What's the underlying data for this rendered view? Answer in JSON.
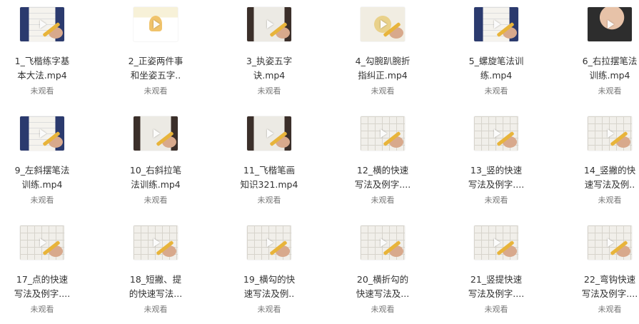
{
  "status_label": "未观看",
  "videos": [
    {
      "title": "1_飞楷练字基\n本大法.mp4",
      "thumb": "blue"
    },
    {
      "title": "2_正姿两件事\n和坐姿五字..",
      "thumb": "cartoon"
    },
    {
      "title": "3_执姿五字\n诀.mp4",
      "thumb": "dark"
    },
    {
      "title": "4_勾腕趴腕折\n指纠正.mp4",
      "thumb": "gold"
    },
    {
      "title": "5_螺旋笔法训\n练.mp4",
      "thumb": "blue"
    },
    {
      "title": "6_右拉摆笔法\n训练.mp4",
      "thumb": "neck"
    },
    {
      "title": "9_左斜摆笔法\n训练.mp4",
      "thumb": "blue"
    },
    {
      "title": "10_右斜拉笔\n法训练.mp4",
      "thumb": "dark"
    },
    {
      "title": "11_飞楷笔画\n知识321.mp4",
      "thumb": "dark"
    },
    {
      "title": "12_横的快速\n写法及例字....",
      "thumb": "grid"
    },
    {
      "title": "13_竖的快速\n写法及例字....",
      "thumb": "grid"
    },
    {
      "title": "14_竖撇的快\n速写法及例..",
      "thumb": "grid"
    },
    {
      "title": "17_点的快速\n写法及例字....",
      "thumb": "grid"
    },
    {
      "title": "18_短撇、提\n的快速写法...",
      "thumb": "grid"
    },
    {
      "title": "19_横勾的快\n速写法及例..",
      "thumb": "grid"
    },
    {
      "title": "20_横折勾的\n快速写法及...",
      "thumb": "grid"
    },
    {
      "title": "21_竖提快速\n写法及例字....",
      "thumb": "grid"
    },
    {
      "title": "22_弯钩快速\n写法及例字....",
      "thumb": "grid"
    }
  ]
}
